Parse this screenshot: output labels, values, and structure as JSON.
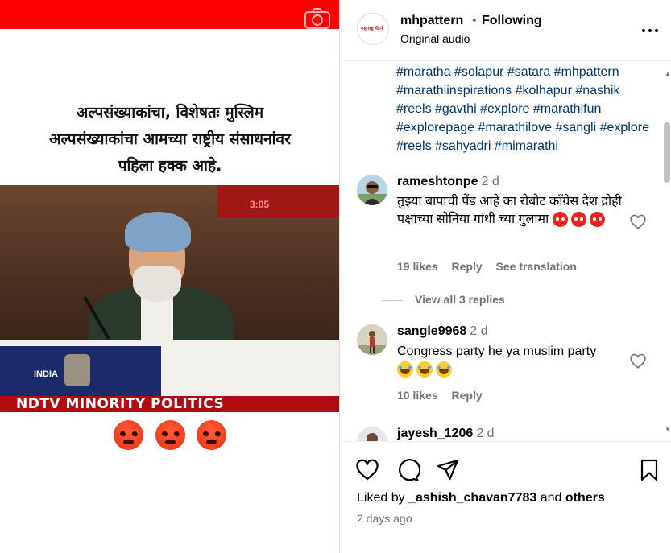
{
  "post": {
    "headline": "अल्पसंख्याकांचा, विशेषतः मुस्लिम अल्पसंख्याकांचा आमच्या राष्ट्रीय संसाधनांवर पहिला हक्क आहे.",
    "video_banner": "NDTV MINORITY POLITICS",
    "video_ticker": "3:05",
    "video_sign": "INDIA"
  },
  "header": {
    "avatar_text": "महाराष्ट्र पॅटर्न",
    "username": "mhpattern",
    "dot": "•",
    "following": "Following",
    "audio": "Original audio"
  },
  "hashtags": "#maratha #solapur #satara #mhpattern #marathiinspirations #kolhapur #nashik #reels #gavthi #explore #marathifun #explorepage #marathilove #sangli #explore #reels #sahyadri #mimarathi",
  "comments": [
    {
      "username": "rameshtonpe",
      "time": "2 d",
      "text": "तुझ्या बापाची पेंड आहे का रोबोट कॉंग्रेस देश द्रोही पक्षाच्या सोनिया गांधी च्या गुलामा",
      "likes": "19 likes",
      "reply": "Reply",
      "translation": "See translation"
    },
    {
      "username": "sangle9968",
      "time": "2 d",
      "text": "Congress party he ya muslim party",
      "likes": "10 likes",
      "reply": "Reply"
    },
    {
      "username": "jayesh_1206",
      "time": "2 d"
    }
  ],
  "view_replies": "View all 3 replies",
  "footer": {
    "liked_prefix": "Liked by",
    "liked_user": "_ashish_chavan7783",
    "liked_and": "and",
    "liked_others": "others",
    "posted": "2 days ago"
  }
}
